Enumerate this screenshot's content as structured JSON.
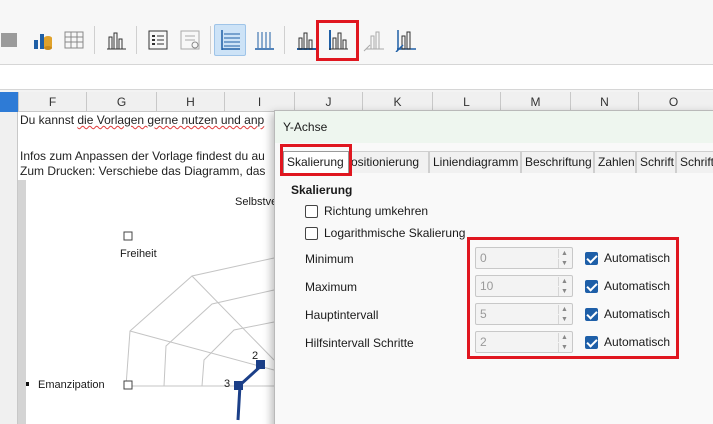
{
  "toolbar": {
    "icons": [
      "chart-data-icon",
      "data-table-icon",
      "chart-type-icon",
      "legend-icon",
      "format-selection-icon",
      "horizontal-grids-icon",
      "vertical-grids-icon",
      "x-axis-icon",
      "y-axis-icon",
      "z-axis-icon",
      "all-axes-icon"
    ],
    "active": "horizontal-grids-icon",
    "highlighted": "y-axis-icon"
  },
  "columns": [
    "F",
    "G",
    "H",
    "I",
    "J",
    "K",
    "L",
    "M",
    "N",
    "O"
  ],
  "sheet": {
    "line1_a": "Du kannst",
    "line1_b": "die Vorlagen gerne nutzen und anp",
    "line2": "Infos zum Anpassen der Vorlage findest du au",
    "line3": "Zum Drucken: Verschiebe das Diagramm, das"
  },
  "chart": {
    "labels": {
      "selbst": "Selbstve",
      "freiheit": "Freiheit",
      "emanzipation": "Emanzipation"
    },
    "ticks": [
      "2",
      "3"
    ]
  },
  "dialog": {
    "title": "Y-Achse",
    "tabs": [
      "Skalierung",
      "Positionierung",
      "Liniendiagramm",
      "Beschriftung",
      "Zahlen",
      "Schrift",
      "Schrifte"
    ],
    "selected_tab": "Skalierung",
    "section_title": "Skalierung",
    "reverse_label": "Richtung umkehren",
    "reverse_checked": false,
    "log_label": "Logarithmische Skalierung",
    "log_checked": false,
    "fields": [
      {
        "label": "Minimum",
        "value": "0",
        "auto_label": "Automatisch",
        "auto": true
      },
      {
        "label": "Maximum",
        "value": "10",
        "auto_label": "Automatisch",
        "auto": true
      },
      {
        "label": "Hauptintervall",
        "value": "5",
        "auto_label": "Automatisch",
        "auto": true
      },
      {
        "label": "Hilfsintervall Schritte",
        "value": "2",
        "auto_label": "Automatisch",
        "auto": true
      }
    ]
  },
  "colors": {
    "highlight": "#e0161f",
    "accent": "#1e5fa8",
    "dialog_title_bg": "#eef6ef"
  }
}
